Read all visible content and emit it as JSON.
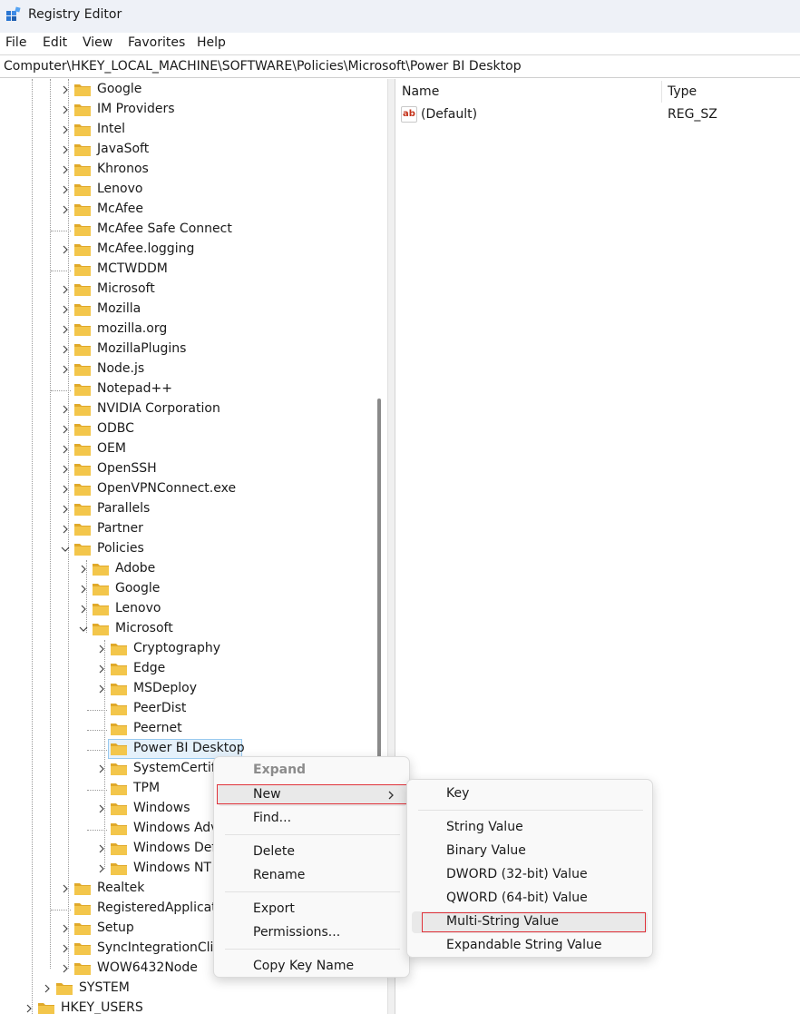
{
  "window": {
    "title": "Registry Editor",
    "icon": "registry-editor-icon"
  },
  "menubar": [
    "File",
    "Edit",
    "View",
    "Favorites",
    "Help"
  ],
  "address": "Computer\\HKEY_LOCAL_MACHINE\\SOFTWARE\\Policies\\Microsoft\\Power BI Desktop",
  "tree": {
    "level1": [
      {
        "label": "Google",
        "expand": true
      },
      {
        "label": "IM Providers",
        "expand": true
      },
      {
        "label": "Intel",
        "expand": true
      },
      {
        "label": "JavaSoft",
        "expand": true
      },
      {
        "label": "Khronos",
        "expand": true
      },
      {
        "label": "Lenovo",
        "expand": true
      },
      {
        "label": "McAfee",
        "expand": true
      },
      {
        "label": "McAfee Safe Connect",
        "expand": false
      },
      {
        "label": "McAfee.logging",
        "expand": true
      },
      {
        "label": "MCTWDDM",
        "expand": false
      },
      {
        "label": "Microsoft",
        "expand": true
      },
      {
        "label": "Mozilla",
        "expand": true
      },
      {
        "label": "mozilla.org",
        "expand": true
      },
      {
        "label": "MozillaPlugins",
        "expand": true
      },
      {
        "label": "Node.js",
        "expand": true
      },
      {
        "label": "Notepad++",
        "expand": false
      },
      {
        "label": "NVIDIA Corporation",
        "expand": true
      },
      {
        "label": "ODBC",
        "expand": true
      },
      {
        "label": "OEM",
        "expand": true
      },
      {
        "label": "OpenSSH",
        "expand": true
      },
      {
        "label": "OpenVPNConnect.exe",
        "expand": true
      },
      {
        "label": "Parallels",
        "expand": true
      },
      {
        "label": "Partner",
        "expand": true
      },
      {
        "label": "Policies",
        "expand": "open"
      }
    ],
    "policies_children": [
      {
        "label": "Adobe",
        "expand": true
      },
      {
        "label": "Google",
        "expand": true
      },
      {
        "label": "Lenovo",
        "expand": true
      },
      {
        "label": "Microsoft",
        "expand": "open"
      }
    ],
    "microsoft_children": [
      {
        "label": "Cryptography",
        "expand": true
      },
      {
        "label": "Edge",
        "expand": true
      },
      {
        "label": "MSDeploy",
        "expand": true
      },
      {
        "label": "PeerDist",
        "expand": false
      },
      {
        "label": "Peernet",
        "expand": false
      },
      {
        "label": "Power BI Desktop",
        "expand": false,
        "selected": true
      },
      {
        "label": "SystemCertifi",
        "expand": true
      },
      {
        "label": "TPM",
        "expand": false
      },
      {
        "label": "Windows",
        "expand": true
      },
      {
        "label": "Windows Adv",
        "expand": false
      },
      {
        "label": "Windows Def",
        "expand": true
      },
      {
        "label": "Windows NT",
        "expand": true
      }
    ],
    "level1_after": [
      {
        "label": "Realtek",
        "expand": true
      },
      {
        "label": "RegisteredApplicat",
        "expand": false
      },
      {
        "label": "Setup",
        "expand": true
      },
      {
        "label": "SyncIntegrationClie",
        "expand": true
      },
      {
        "label": "WOW6432Node",
        "expand": true
      }
    ],
    "level0": [
      {
        "label": "SYSTEM",
        "expand": true
      },
      {
        "label": "HKEY_USERS",
        "expand": true
      }
    ]
  },
  "list": {
    "col_name": "Name",
    "col_type": "Type",
    "rows": [
      {
        "name": "(Default)",
        "type": "REG_SZ",
        "icon": "string-value-icon"
      }
    ]
  },
  "context_menu": {
    "expand": "Expand",
    "new": "New",
    "find": "Find...",
    "delete": "Delete",
    "rename": "Rename",
    "export": "Export",
    "permissions": "Permissions...",
    "copy_key_name": "Copy Key Name"
  },
  "submenu": {
    "key": "Key",
    "string_value": "String Value",
    "binary_value": "Binary Value",
    "dword_value": "DWORD (32-bit) Value",
    "qword_value": "QWORD (64-bit) Value",
    "multi_string_value": "Multi-String Value",
    "expandable_string_value": "Expandable String Value"
  },
  "colors": {
    "folder": "#f3c64b",
    "selection": "#e5f1fb",
    "highlight_box": "#e0323a"
  }
}
